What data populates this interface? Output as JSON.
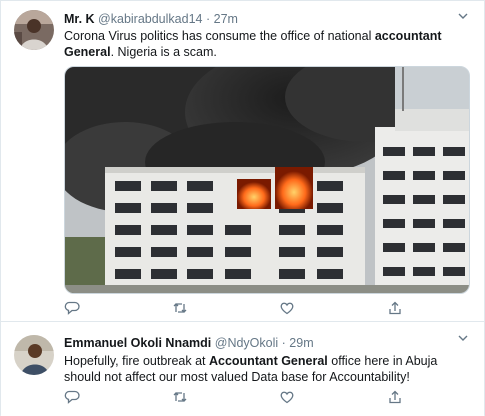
{
  "tweets": [
    {
      "name": "Mr. K",
      "handle": "@kabirabdulkad14",
      "separator": "·",
      "time": "27m",
      "text_parts": [
        {
          "t": "Corona Virus politics has consume the office of national ",
          "b": false
        },
        {
          "t": "accountant General",
          "b": true
        },
        {
          "t": ". Nigeria is a scam.",
          "b": false
        }
      ],
      "has_media": true
    },
    {
      "name": "Emmanuel Okoli Nnamdi",
      "handle": "@NdyOkoli",
      "separator": "·",
      "time": "29m",
      "text_parts": [
        {
          "t": "Hopefully, fire outbreak at ",
          "b": false
        },
        {
          "t": "Accountant General",
          "b": true
        },
        {
          "t": " office  here in Abuja should not affect our most valued Data base for Accountability!",
          "b": false
        }
      ],
      "has_media": false
    }
  ],
  "icons": {
    "reply": "reply-icon",
    "retweet": "retweet-icon",
    "like": "like-icon",
    "share": "share-icon",
    "more": "chevron-down-icon"
  },
  "colors": {
    "text": "#14171a",
    "secondary": "#657786",
    "border": "#e1e8ed"
  }
}
